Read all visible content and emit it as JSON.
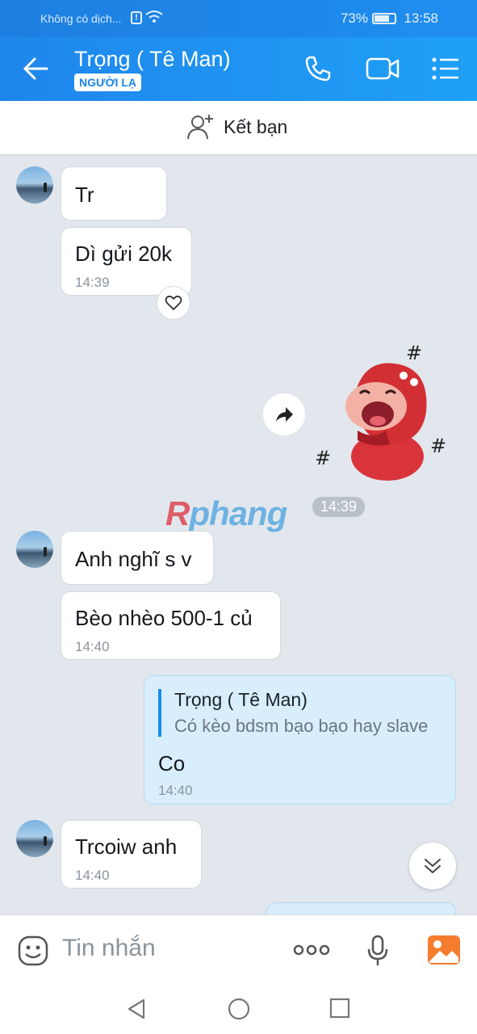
{
  "status_bar": {
    "carrier": "Không có dịch...",
    "battery": "73%",
    "battery_level": 0.73,
    "time": "13:58"
  },
  "header": {
    "title": "Trọng ( Tê Man)",
    "badge": "NGƯỜI LẠ",
    "icons": [
      "back-arrow-icon",
      "phone-icon",
      "video-call-icon",
      "menu-list-icon"
    ]
  },
  "add_friend": {
    "label": "Kết bạn",
    "icon": "add-person-icon"
  },
  "messages": [
    {
      "text": "Tr"
    },
    {
      "text": "Dì gửi 20k",
      "time": "14:39"
    },
    {
      "sticker": "laughing-red-hood-sticker",
      "time": "14:39"
    },
    {
      "text": "Anh nghĩ s v"
    },
    {
      "text": "Bèo nhèo 500-1 củ",
      "time": "14:40"
    },
    {
      "quote_name": "Trọng ( Tê Man)",
      "quote_text": "Có kèo bdsm bạo bạo hay slave",
      "text": "Co",
      "time": "14:40"
    },
    {
      "text": "Trcoiw anh",
      "time": "14:40"
    }
  ],
  "watermark": {
    "part1": "R",
    "part2": "phang"
  },
  "input": {
    "placeholder": "Tin nhắn"
  },
  "colors": {
    "accent": "#1f86ec",
    "my_bubble": "#d8eefc",
    "background": "#e2e7ed"
  }
}
